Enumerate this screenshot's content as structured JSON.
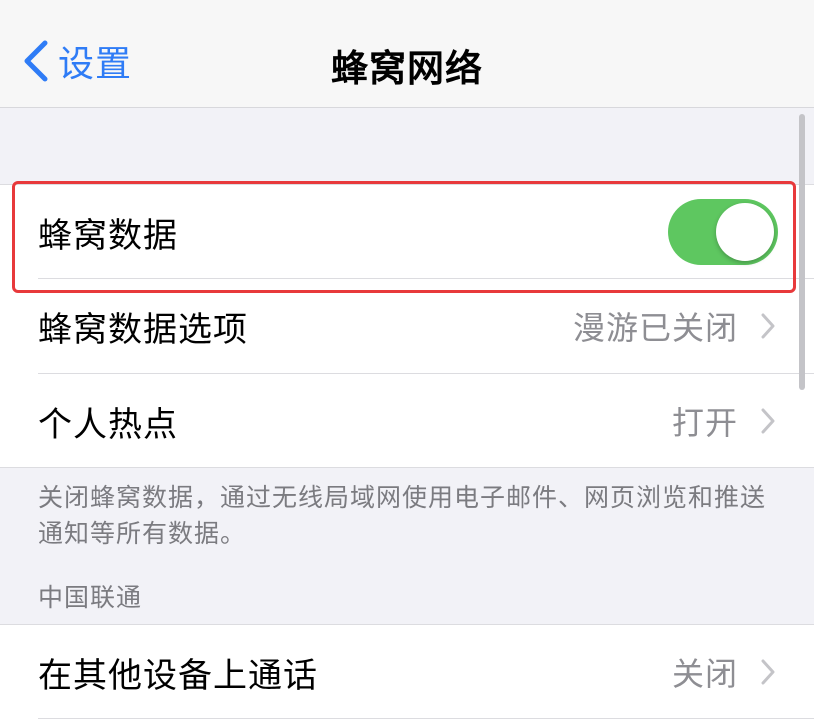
{
  "nav": {
    "back_label": "设置",
    "title": "蜂窝网络"
  },
  "cellular": {
    "data_label": "蜂窝数据",
    "data_enabled": true,
    "options_label": "蜂窝数据选项",
    "options_value": "漫游已关闭",
    "hotspot_label": "个人热点",
    "hotspot_value": "打开"
  },
  "footer_text": "关闭蜂窝数据，通过无线局域网使用电子邮件、网页浏览和推送通知等所有数据。",
  "carrier": {
    "section_title": "中国联通",
    "calls_label": "在其他设备上通话",
    "calls_value": "关闭"
  },
  "colors": {
    "accent": "#2f7cf6",
    "toggle_on": "#5ec760",
    "highlight": "#e8393b"
  }
}
